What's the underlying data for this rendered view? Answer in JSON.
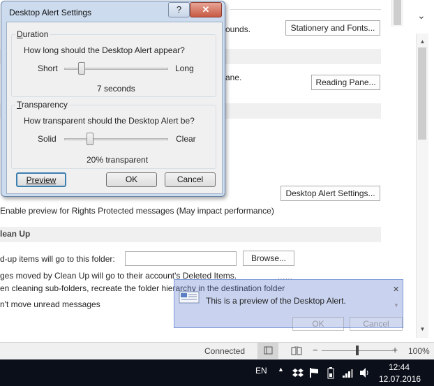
{
  "dialog": {
    "title": "Desktop Alert Settings",
    "help_glyph": "?",
    "close_glyph": "✕",
    "duration": {
      "group_label": "Duration",
      "question": "How long should the Desktop Alert appear?",
      "min_label": "Short",
      "max_label": "Long",
      "value_text": "7 seconds",
      "level": 0.17
    },
    "transparency": {
      "group_label": "Transparency",
      "question": "How transparent should the Desktop Alert be?",
      "min_label": "Solid",
      "max_label": "Clear",
      "value_text": "20% transparent",
      "level": 0.25
    },
    "preview_label": "Preview",
    "ok_label": "OK",
    "cancel_label": "Cancel"
  },
  "options": {
    "stationery_text": "ounds.",
    "stationery_button": "Stationery and Fonts...",
    "reading_text": "ane.",
    "reading_button": "Reading Pane...",
    "desktop_alert_button": "Desktop Alert Settings...",
    "rights_checkbox_label": "Enable preview for Rights Protected messages (May impact performance)",
    "cleanup_header": "lean Up",
    "cleanup_folder_label": "d-up items will go to this folder:",
    "cleanup_folder_value": "",
    "browse_button": "Browse...",
    "cleanup_line2": "ges moved by Clean Up will go to their account's Deleted Items.",
    "cleanup_line3": "en cleaning sub-folders, recreate the folder hierarchy in the destination folder",
    "cleanup_line4": "n't move unread messages"
  },
  "alert_preview": {
    "message": "This is a preview of the Desktop Alert.",
    "ok_label": "OK",
    "cancel_label": "Cancel",
    "close_glyph": "✕"
  },
  "statusbar": {
    "connected": "Connected",
    "zoom_minus": "−",
    "zoom_plus": "+",
    "zoom_level": "100%",
    "zoom_fraction": 0.5
  },
  "taskbar": {
    "language": "EN",
    "time": "12:44",
    "date": "12.07.2016"
  },
  "chrome": {
    "ribbon_toggle": "⌄"
  }
}
